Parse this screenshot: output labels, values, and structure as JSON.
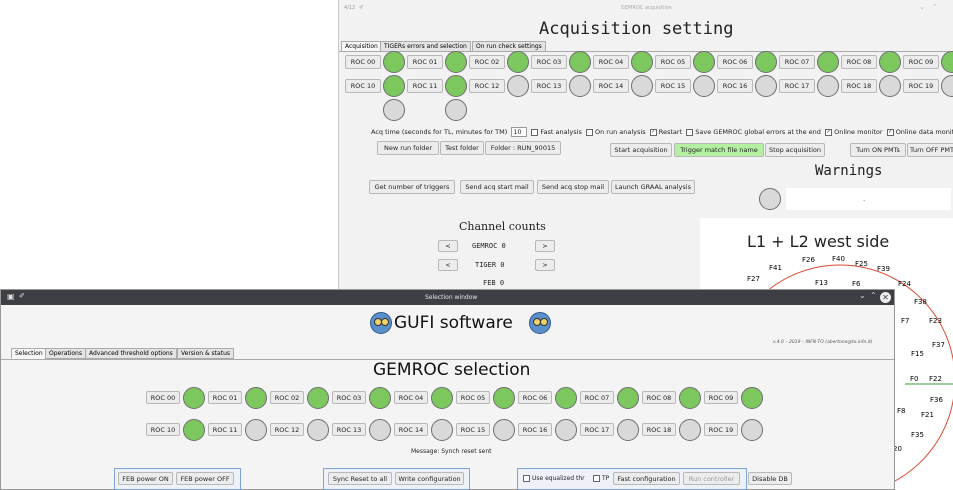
{
  "back": {
    "title_small": "4/12",
    "window_title": "GEMROC acquisition",
    "heading": "Acquisition setting",
    "tabs": [
      "Acquisition",
      "TIGERs errors and selection",
      "On run check settings"
    ],
    "roc_row1": [
      "ROC 00",
      "ROC 01",
      "ROC 02",
      "ROC 03",
      "ROC 04",
      "ROC 05",
      "ROC 06",
      "ROC 07",
      "ROC 08",
      "ROC 09"
    ],
    "roc_row2": [
      "ROC 10",
      "ROC 11",
      "ROC 12",
      "ROC 13",
      "ROC 14",
      "ROC 15",
      "ROC 16",
      "ROC 17",
      "ROC 18",
      "ROC 19"
    ],
    "acq_label": "Acq time (seconds for TL, minutes for TM)",
    "acq_value": "10",
    "opt_fast": "Fast analysis",
    "opt_onrun": "On run analysis",
    "opt_restart": "Restart",
    "opt_save": "Save GEMROC global errors at the end",
    "opt_online_mon": "Online monitor",
    "opt_online_data": "Online data monitor",
    "new_run_folder": "New run folder",
    "test_folder": "Test folder",
    "folder": "Folder : RUN_90015",
    "start_acq": "Start acquisition",
    "trigger_match": "Trigger match file name",
    "stop_acq": "Stop acquisition",
    "turn_on_pmts": "Turn ON PMTs",
    "turn_off_pmts": "Turn OFF PMT",
    "get_triggers": "Get number of triggers",
    "send_start_mail": "Send acq start mail",
    "send_stop_mail": "Send acq stop mail",
    "launch_graal": "Launch GRAAL analysis",
    "warnings": "Warnings",
    "warnings_value": "-",
    "channel_counts": "Channel counts",
    "prev": "<",
    "next": ">",
    "gemroc_sel": "GEMROC 0",
    "tiger_sel": "TIGER 0",
    "feb_sel": "FEB 0",
    "plot_title": "L1 + L2 west side",
    "feb_labels": [
      "F26",
      "F40",
      "F41",
      "F25",
      "F39",
      "F27",
      "F13",
      "F6",
      "F24",
      "F38",
      "F7",
      "F23",
      "F37",
      "F15",
      "F0",
      "F22",
      "F36",
      "F8",
      "F21",
      "F35",
      "20"
    ]
  },
  "front": {
    "window_title": "Selection window",
    "logo_text": "GUFI software",
    "version": "v.4.0 – 2019 – INFN-TO (abertone@to.infn.it)",
    "tabs": [
      "Selection",
      "Operations",
      "Advanced threshold options",
      "Version & status"
    ],
    "heading": "GEMROC selection",
    "roc_row1": [
      "ROC 00",
      "ROC 01",
      "ROC 02",
      "ROC 03",
      "ROC 04",
      "ROC 05",
      "ROC 06",
      "ROC 07",
      "ROC 08",
      "ROC 09"
    ],
    "roc_row2": [
      "ROC 10",
      "ROC 11",
      "ROC 12",
      "ROC 13",
      "ROC 14",
      "ROC 15",
      "ROC 16",
      "ROC 17",
      "ROC 18",
      "ROC 19"
    ],
    "message": "Message: Synch reset sent",
    "feb_on": "FEB power ON",
    "feb_off": "FEB power OFF",
    "sync_reset": "Sync Reset to all",
    "write_config": "Write configuration",
    "use_eq": "Use equalized thr",
    "tp": "TP",
    "fast_config": "Fast configuration",
    "run_controller": "Run controller",
    "disable_db": "Disable DB"
  }
}
